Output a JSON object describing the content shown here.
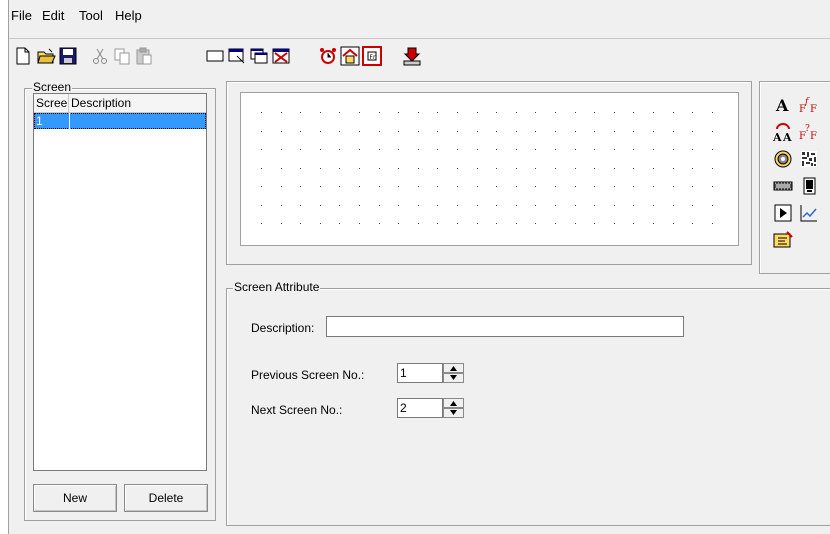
{
  "menu": [
    "File",
    "Edit",
    "Tool",
    "Help"
  ],
  "toolbar": {
    "icons": [
      "new-file-icon",
      "open-folder-icon",
      "save-icon",
      "cut-icon",
      "copy-icon",
      "paste-icon",
      "screen-rect-icon",
      "screen-properties-icon",
      "screen-copy-icon",
      "screen-delete-icon",
      "alarm-clock-icon",
      "home-icon",
      "function-key-icon",
      "download-icon"
    ]
  },
  "screen_panel": {
    "title": "Screen",
    "columns": [
      "Scree",
      "Description"
    ],
    "rows": [
      {
        "no": "1",
        "description": ""
      }
    ],
    "new_label": "New",
    "delete_label": "Delete"
  },
  "palette": {
    "icons": [
      "text-a-icon",
      "formula-icon",
      "text-swap-icon",
      "formula-question-icon",
      "circle-target-icon",
      "barcode-icon",
      "film-icon",
      "phone-icon",
      "play-button-icon",
      "trend-chart-icon",
      "hand-pointer-icon"
    ]
  },
  "attribute": {
    "title": "Screen Attribute",
    "description_label": "Description:",
    "description_value": "",
    "previous_label": "Previous Screen No.:",
    "previous_value": "1",
    "next_label": "Next Screen No.:",
    "next_value": "2"
  },
  "colors": {
    "selection": "#3399ff",
    "window_bg": "#f0f0f0",
    "icon_red": "#cc0000",
    "icon_teal": "#008080"
  }
}
